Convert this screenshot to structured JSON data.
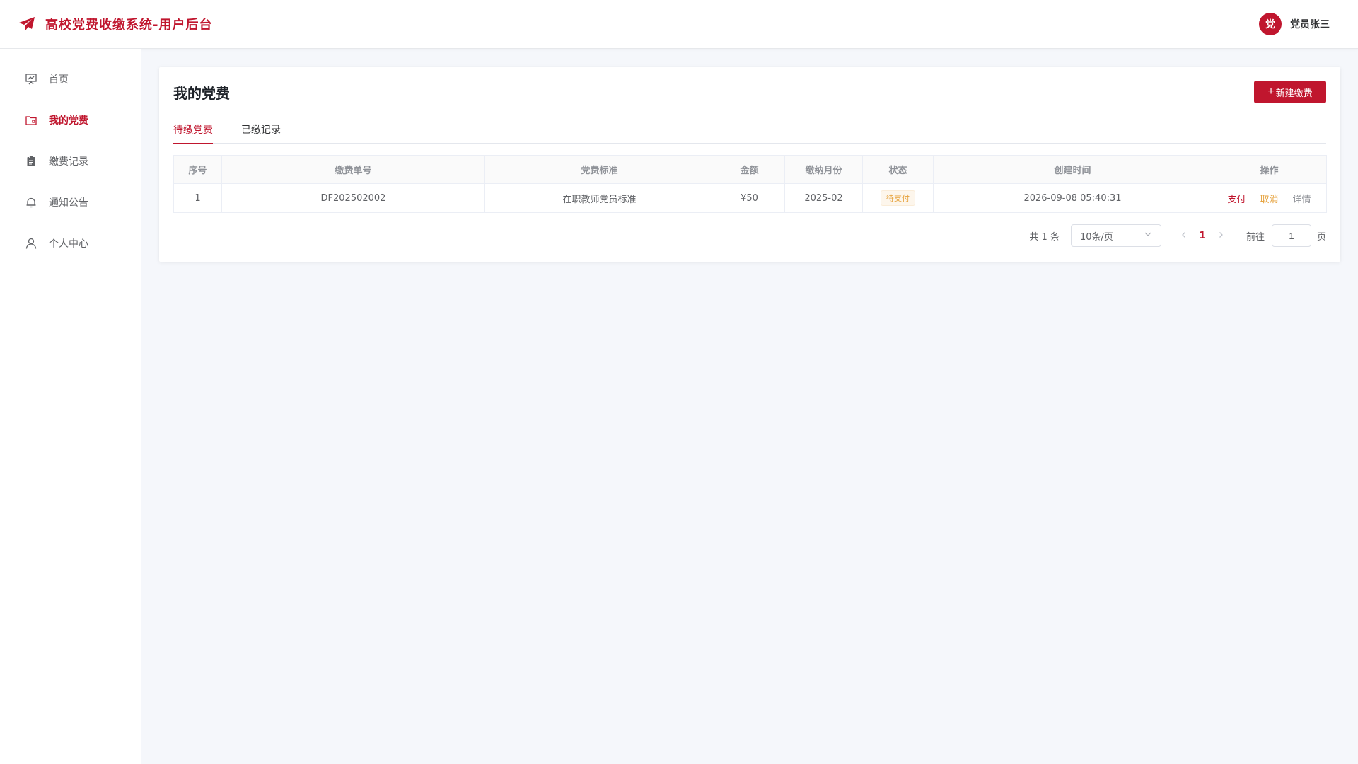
{
  "header": {
    "title": "高校党费收缴系统-用户后台",
    "avatar_text": "党",
    "username": "党员张三"
  },
  "sidebar": {
    "items": [
      {
        "label": "首页",
        "icon": "presentation-board-icon"
      },
      {
        "label": "我的党费",
        "icon": "folder-icon",
        "active": true
      },
      {
        "label": "缴费记录",
        "icon": "clipboard-icon"
      },
      {
        "label": "通知公告",
        "icon": "bell-icon"
      },
      {
        "label": "个人中心",
        "icon": "user-icon"
      }
    ]
  },
  "main": {
    "title": "我的党费",
    "new_button": "新建缴费",
    "tabs": [
      {
        "label": "待缴党费",
        "active": true
      },
      {
        "label": "已缴记录"
      }
    ],
    "table": {
      "headers": [
        "序号",
        "缴费单号",
        "党费标准",
        "金额",
        "缴纳月份",
        "状态",
        "创建时间",
        "操作"
      ],
      "rows": [
        {
          "index": "1",
          "order_no": "DF202502002",
          "standard": "在职教师党员标准",
          "amount": "¥50",
          "month": "2025-02",
          "status": "待支付",
          "created": "2026-09-08 05:40:31",
          "actions": {
            "pay": "支付",
            "cancel": "取消",
            "detail": "详情"
          }
        }
      ]
    },
    "pagination": {
      "total": "共 1 条",
      "page_size": "10条/页",
      "current_page": "1",
      "goto_label": "前往",
      "goto_value": "1",
      "goto_unit": "页"
    }
  },
  "colors": {
    "primary": "#c0162e",
    "warning": "#e6a23c",
    "background": "#f5f7fb"
  }
}
